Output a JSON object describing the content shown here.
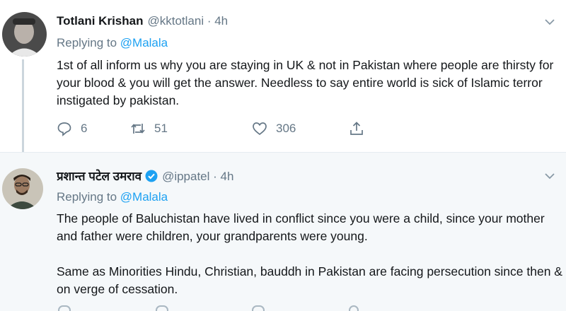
{
  "tweets": [
    {
      "name": "Totlani Krishan",
      "handle": "@kktotlani · 4h",
      "replying_prefix": "Replying to ",
      "replying_to": "@Malala",
      "paragraphs": [
        "1st of all inform us why you are staying in UK & not in Pakistan where people are thirsty for your blood & you will get the answer. Needless to say entire world is sick of Islamic terror instigated by pakistan."
      ],
      "actions": {
        "replies": "6",
        "retweets": "51",
        "likes": "306"
      },
      "icons": [
        "reply-icon",
        "retweet-icon",
        "like-icon",
        "share-icon",
        "chevron-down-icon"
      ]
    },
    {
      "name": "प्रशान्त पटेल उमराव",
      "verified": true,
      "handle": "@ippatel · 4h",
      "replying_prefix": "Replying to ",
      "replying_to": "@Malala",
      "paragraphs": [
        "The people of Baluchistan have lived in conflict since you were a child, since your mother and father were children, your grandparents were young.",
        "Same as Minorities Hindu, Christian, bauddh in Pakistan are facing persecution since then & on verge of cessation."
      ],
      "icons": [
        "verified-badge-icon",
        "chevron-down-icon"
      ]
    }
  ],
  "colors": {
    "accent": "#1da1f2",
    "secondary_text": "#657786",
    "thread_line": "#ccd6dd",
    "highlight_bg": "#f5f8fa"
  }
}
